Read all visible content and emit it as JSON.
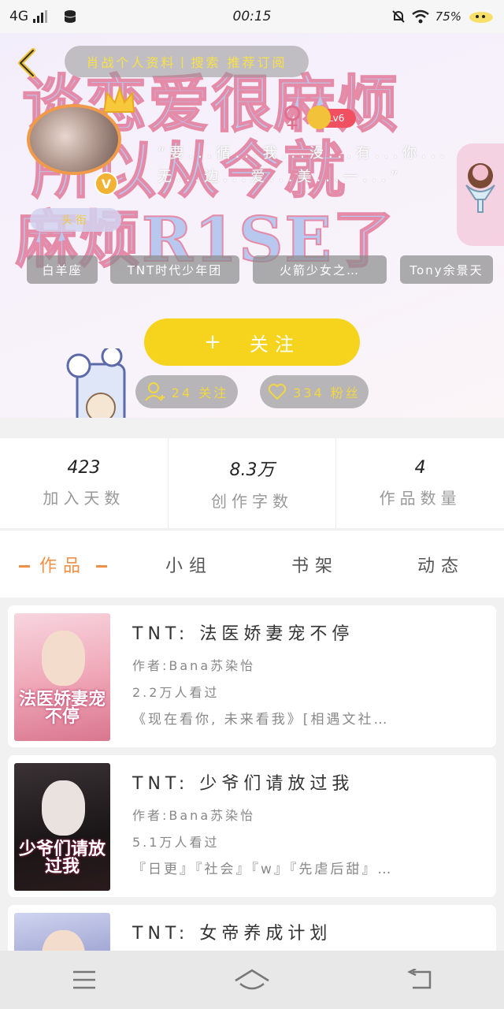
{
  "status_bar": {
    "network": "4G",
    "time": "00:15",
    "battery": "75%",
    "icons": [
      "signal-icon",
      "database-icon",
      "mute-bell-icon",
      "wifi-icon",
      "battery-icon"
    ]
  },
  "header": {
    "back_icon": "chevron-left-icon",
    "notice": "肖战个人资料丨搜索 推荐订阅"
  },
  "profile": {
    "cover_text": [
      "谈恋爱很麻烦",
      "所以从今就",
      "麻烦R1SE了"
    ],
    "gender_symbol": "♀",
    "level": "Lv6",
    "vip_badge": "V",
    "bio": "“要...循...我...没...有...你...无...边...爱...美...一...”",
    "title_tag": "头衔",
    "hashtags": [
      "白羊座",
      "TNT时代少年团",
      "火箭少女之…",
      "Tony余景天"
    ],
    "follow_label": "关注",
    "follow_icon": "plus-icon",
    "following_label": "24 关注",
    "fans_label": "334 粉丝"
  },
  "stats": [
    {
      "value": "423",
      "label": "加入天数"
    },
    {
      "value": "8.3万",
      "label": "创作字数"
    },
    {
      "value": "4",
      "label": "作品数量"
    }
  ],
  "tabs": [
    {
      "label": "作品",
      "active": true
    },
    {
      "label": "小组",
      "active": false
    },
    {
      "label": "书架",
      "active": false
    },
    {
      "label": "动态",
      "active": false
    }
  ],
  "works": [
    {
      "title": "TNT: 法医娇妻宠不停",
      "author": "作者:Bana苏染怡",
      "reads": "2.2万人看过",
      "desc": "《现在看你, 未来看我》[相遇文社…",
      "cover_text": "法医娇妻宠不停"
    },
    {
      "title": "TNT: 少爷们请放过我",
      "author": "作者:Bana苏染怡",
      "reads": "5.1万人看过",
      "desc": "『日更』『社会』『w』『先虐后甜』…",
      "cover_text": "少爷们请放过我"
    },
    {
      "title": "TNT: 女帝养成计划",
      "author": "",
      "reads": "",
      "desc": "",
      "cover_text": ""
    }
  ],
  "navbar": {
    "items": [
      "menu-icon",
      "home-icon",
      "back-icon"
    ]
  },
  "colors": {
    "accent_yellow": "#f6d41d",
    "accent_orange": "#ee9045",
    "level_red": "#f05060"
  }
}
